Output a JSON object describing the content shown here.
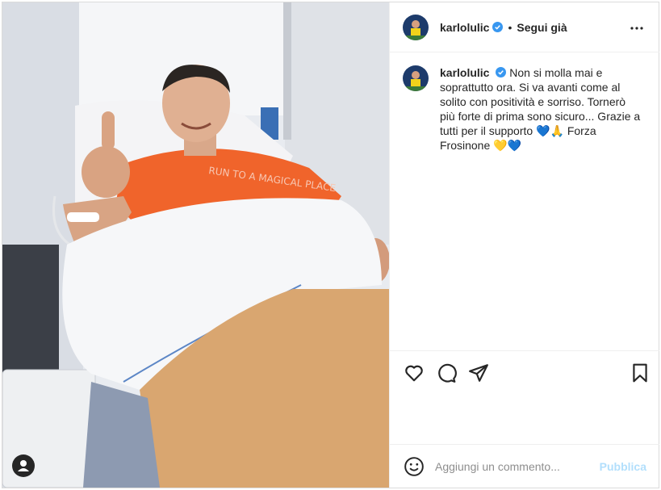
{
  "post": {
    "username": "karlolulic",
    "follow_label": "Segui già",
    "separator": "•"
  },
  "caption": {
    "username": "karlolulic",
    "text": "Non si molla mai e soprattutto ora. Si va avanti come al solito con positività e sorriso. Tornerò più forte di prima sono sicuro... Grazie a tutti per il supporto 💙🙏 Forza Frosinone 💛💙"
  },
  "photo": {
    "shirt_text": "RUN TO A MAGICAL PLACE"
  },
  "comment": {
    "placeholder": "Aggiungi un commento...",
    "publish_label": "Pubblica"
  },
  "icons": {
    "verified": "verified-badge-icon",
    "more": "more-options-icon",
    "like": "heart-icon",
    "comment": "comment-bubble-icon",
    "share": "paper-plane-icon",
    "save": "bookmark-icon",
    "emoji": "emoji-icon",
    "tagged_users": "user-tag-icon"
  },
  "colors": {
    "verified": "#3897f0",
    "publish_disabled": "#b2dffc",
    "border": "#efefef",
    "shirt": "#f0642b"
  }
}
